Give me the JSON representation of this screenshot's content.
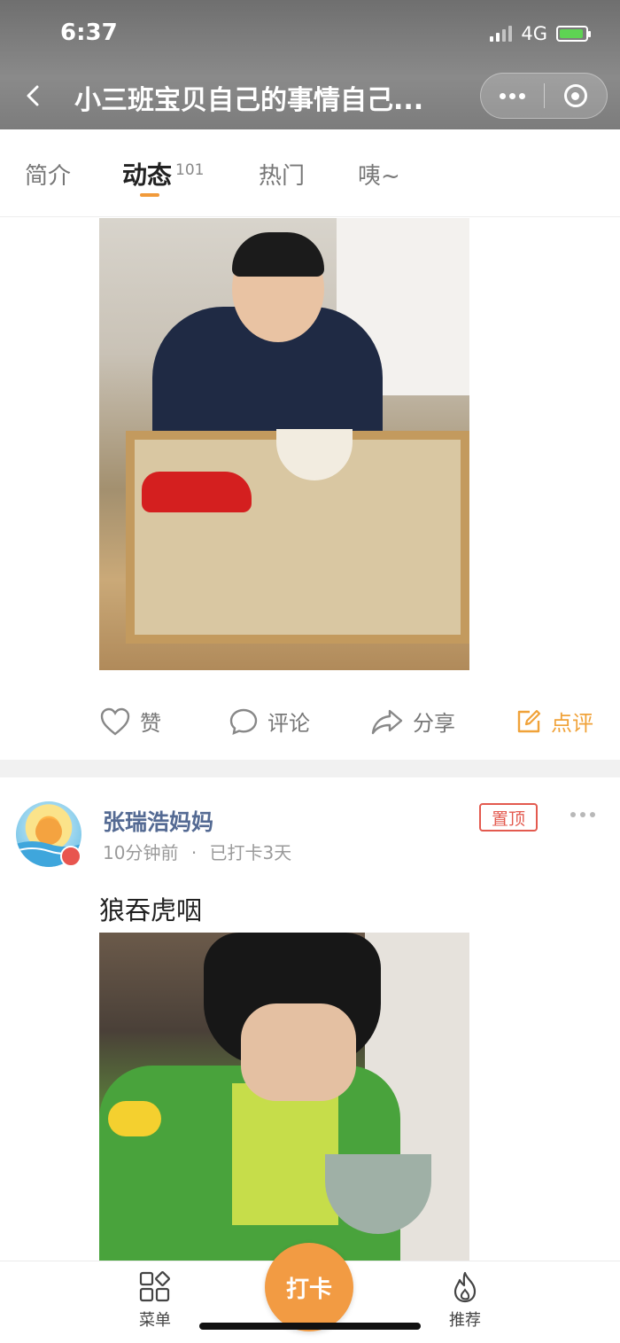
{
  "status": {
    "time": "6:37",
    "network": "4G"
  },
  "nav": {
    "title": "小三班宝贝自己的事情自己..."
  },
  "tabs": [
    {
      "label": "简介"
    },
    {
      "label": "动态",
      "count": "101"
    },
    {
      "label": "热门"
    },
    {
      "label": "咦~"
    }
  ],
  "actions": {
    "like": "赞",
    "comment": "评论",
    "share": "分享",
    "review": "点评"
  },
  "post": {
    "author": "张瑞浩妈妈",
    "time": "10分钟前",
    "separator": "·",
    "checkin_info": "已打卡3天",
    "pin_label": "置顶",
    "text": "狼吞虎咽"
  },
  "bottom_nav": {
    "menu": "菜单",
    "checkin": "打卡",
    "recommend": "推荐"
  },
  "colors": {
    "accent": "#f19a3a",
    "pin": "#e35a4f",
    "author": "#546a93"
  }
}
